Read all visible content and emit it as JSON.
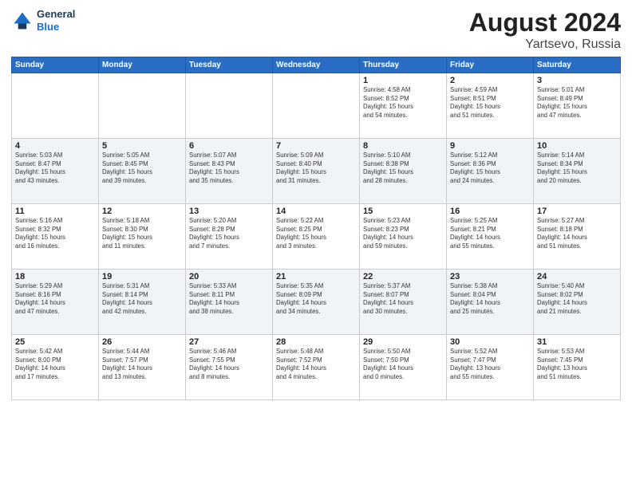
{
  "header": {
    "logo_line1": "General",
    "logo_line2": "Blue",
    "main_title": "August 2024",
    "subtitle": "Yartsevo, Russia"
  },
  "days_of_week": [
    "Sunday",
    "Monday",
    "Tuesday",
    "Wednesday",
    "Thursday",
    "Friday",
    "Saturday"
  ],
  "weeks": [
    [
      {
        "day": "",
        "text": ""
      },
      {
        "day": "",
        "text": ""
      },
      {
        "day": "",
        "text": ""
      },
      {
        "day": "",
        "text": ""
      },
      {
        "day": "1",
        "text": "Sunrise: 4:58 AM\nSunset: 8:52 PM\nDaylight: 15 hours\nand 54 minutes."
      },
      {
        "day": "2",
        "text": "Sunrise: 4:59 AM\nSunset: 8:51 PM\nDaylight: 15 hours\nand 51 minutes."
      },
      {
        "day": "3",
        "text": "Sunrise: 5:01 AM\nSunset: 8:49 PM\nDaylight: 15 hours\nand 47 minutes."
      }
    ],
    [
      {
        "day": "4",
        "text": "Sunrise: 5:03 AM\nSunset: 8:47 PM\nDaylight: 15 hours\nand 43 minutes."
      },
      {
        "day": "5",
        "text": "Sunrise: 5:05 AM\nSunset: 8:45 PM\nDaylight: 15 hours\nand 39 minutes."
      },
      {
        "day": "6",
        "text": "Sunrise: 5:07 AM\nSunset: 8:43 PM\nDaylight: 15 hours\nand 35 minutes."
      },
      {
        "day": "7",
        "text": "Sunrise: 5:09 AM\nSunset: 8:40 PM\nDaylight: 15 hours\nand 31 minutes."
      },
      {
        "day": "8",
        "text": "Sunrise: 5:10 AM\nSunset: 8:38 PM\nDaylight: 15 hours\nand 28 minutes."
      },
      {
        "day": "9",
        "text": "Sunrise: 5:12 AM\nSunset: 8:36 PM\nDaylight: 15 hours\nand 24 minutes."
      },
      {
        "day": "10",
        "text": "Sunrise: 5:14 AM\nSunset: 8:34 PM\nDaylight: 15 hours\nand 20 minutes."
      }
    ],
    [
      {
        "day": "11",
        "text": "Sunrise: 5:16 AM\nSunset: 8:32 PM\nDaylight: 15 hours\nand 16 minutes."
      },
      {
        "day": "12",
        "text": "Sunrise: 5:18 AM\nSunset: 8:30 PM\nDaylight: 15 hours\nand 11 minutes."
      },
      {
        "day": "13",
        "text": "Sunrise: 5:20 AM\nSunset: 8:28 PM\nDaylight: 15 hours\nand 7 minutes."
      },
      {
        "day": "14",
        "text": "Sunrise: 5:22 AM\nSunset: 8:25 PM\nDaylight: 15 hours\nand 3 minutes."
      },
      {
        "day": "15",
        "text": "Sunrise: 5:23 AM\nSunset: 8:23 PM\nDaylight: 14 hours\nand 59 minutes."
      },
      {
        "day": "16",
        "text": "Sunrise: 5:25 AM\nSunset: 8:21 PM\nDaylight: 14 hours\nand 55 minutes."
      },
      {
        "day": "17",
        "text": "Sunrise: 5:27 AM\nSunset: 8:18 PM\nDaylight: 14 hours\nand 51 minutes."
      }
    ],
    [
      {
        "day": "18",
        "text": "Sunrise: 5:29 AM\nSunset: 8:16 PM\nDaylight: 14 hours\nand 47 minutes."
      },
      {
        "day": "19",
        "text": "Sunrise: 5:31 AM\nSunset: 8:14 PM\nDaylight: 14 hours\nand 42 minutes."
      },
      {
        "day": "20",
        "text": "Sunrise: 5:33 AM\nSunset: 8:11 PM\nDaylight: 14 hours\nand 38 minutes."
      },
      {
        "day": "21",
        "text": "Sunrise: 5:35 AM\nSunset: 8:09 PM\nDaylight: 14 hours\nand 34 minutes."
      },
      {
        "day": "22",
        "text": "Sunrise: 5:37 AM\nSunset: 8:07 PM\nDaylight: 14 hours\nand 30 minutes."
      },
      {
        "day": "23",
        "text": "Sunrise: 5:38 AM\nSunset: 8:04 PM\nDaylight: 14 hours\nand 25 minutes."
      },
      {
        "day": "24",
        "text": "Sunrise: 5:40 AM\nSunset: 8:02 PM\nDaylight: 14 hours\nand 21 minutes."
      }
    ],
    [
      {
        "day": "25",
        "text": "Sunrise: 5:42 AM\nSunset: 8:00 PM\nDaylight: 14 hours\nand 17 minutes."
      },
      {
        "day": "26",
        "text": "Sunrise: 5:44 AM\nSunset: 7:57 PM\nDaylight: 14 hours\nand 13 minutes."
      },
      {
        "day": "27",
        "text": "Sunrise: 5:46 AM\nSunset: 7:55 PM\nDaylight: 14 hours\nand 8 minutes."
      },
      {
        "day": "28",
        "text": "Sunrise: 5:48 AM\nSunset: 7:52 PM\nDaylight: 14 hours\nand 4 minutes."
      },
      {
        "day": "29",
        "text": "Sunrise: 5:50 AM\nSunset: 7:50 PM\nDaylight: 14 hours\nand 0 minutes."
      },
      {
        "day": "30",
        "text": "Sunrise: 5:52 AM\nSunset: 7:47 PM\nDaylight: 13 hours\nand 55 minutes."
      },
      {
        "day": "31",
        "text": "Sunrise: 5:53 AM\nSunset: 7:45 PM\nDaylight: 13 hours\nand 51 minutes."
      }
    ]
  ]
}
